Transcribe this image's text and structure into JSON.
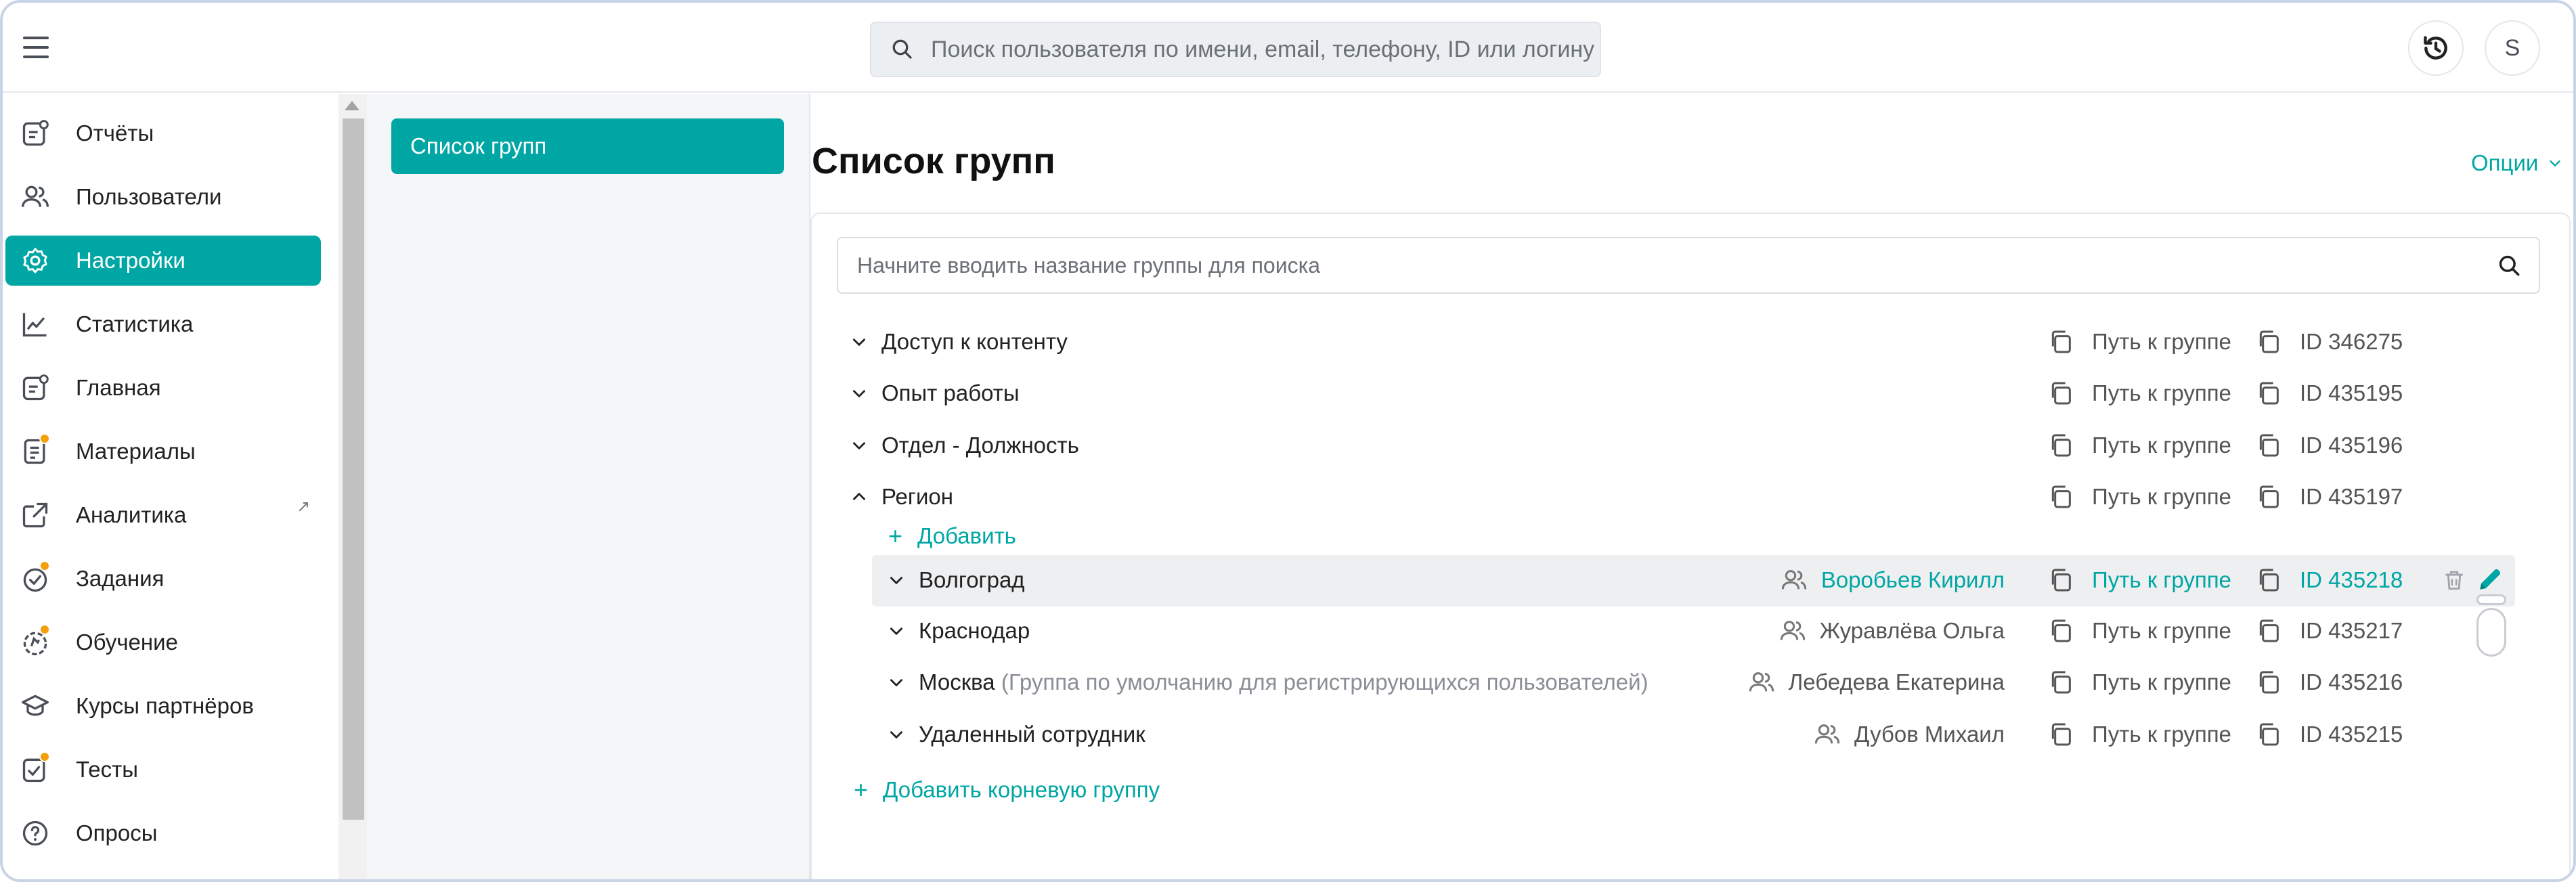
{
  "topbar": {
    "search_placeholder": "Поиск пользователя по имени, email, телефону, ID или логину",
    "avatar_letter": "S"
  },
  "sidebar": {
    "items": [
      {
        "label": "Отчёты",
        "icon": "reports-icon"
      },
      {
        "label": "Пользователи",
        "icon": "users-icon"
      },
      {
        "label": "Настройки",
        "icon": "gear-icon",
        "active": true
      },
      {
        "label": "Статистика",
        "icon": "chart-icon"
      },
      {
        "label": "Главная",
        "icon": "home-icon"
      },
      {
        "label": "Материалы",
        "icon": "materials-icon"
      },
      {
        "label": "Аналитика",
        "icon": "analytics-icon"
      },
      {
        "label": "Задания",
        "icon": "tasks-icon"
      },
      {
        "label": "Обучение",
        "icon": "learning-icon"
      },
      {
        "label": "Курсы партнёров",
        "icon": "partner-courses-icon"
      },
      {
        "label": "Тесты",
        "icon": "tests-icon"
      },
      {
        "label": "Опросы",
        "icon": "surveys-icon"
      }
    ]
  },
  "midpanel": {
    "active_item": "Список групп"
  },
  "main": {
    "title": "Список групп",
    "options_label": "Опции",
    "group_search_placeholder": "Начните вводить название группы для поиска",
    "path_label": "Путь к группе",
    "add_label": "Добавить",
    "add_root_label": "Добавить корневую группу",
    "root_groups": [
      {
        "name": "Доступ к контенту",
        "id": "ID 346275"
      },
      {
        "name": "Опыт работы",
        "id": "ID 435195"
      },
      {
        "name": "Отдел - Должность",
        "id": "ID 435196"
      },
      {
        "name": "Регион",
        "id": "ID 435197"
      }
    ],
    "sub_groups": [
      {
        "name": "Волгоград",
        "note": "",
        "owner": "Воробьев Кирилл",
        "id": "ID 435218"
      },
      {
        "name": "Краснодар",
        "note": "",
        "owner": "Журавлёва Ольга",
        "id": "ID 435217"
      },
      {
        "name": "Москва",
        "note": "(Группа по умолчанию для регистрирующихся пользователей)",
        "owner": "Лебедева Екатерина",
        "id": "ID 435216"
      },
      {
        "name": "Удаленный сотрудник",
        "note": "",
        "owner": "Дубов Михаил",
        "id": "ID 435215"
      }
    ]
  },
  "colors": {
    "accent": "#00a6a4",
    "badge": "#f59e0b"
  }
}
